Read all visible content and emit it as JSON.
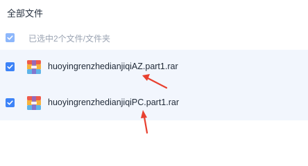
{
  "header": {
    "title": "全部文件"
  },
  "selection": {
    "label": "已选中2个文件/文件夹"
  },
  "files": [
    {
      "name": "huoyingrenzhedianjiqiAZ.part1.rar",
      "checked": true,
      "icon": "rar-archive-icon"
    },
    {
      "name": "huoyingrenzhedianjiqiPC.part1.rar",
      "checked": true,
      "icon": "rar-archive-icon"
    }
  ],
  "colors": {
    "accent": "#3d83f7",
    "selected_row_bg": "#f2f6fd",
    "annotation_arrow": "#e8402f"
  }
}
